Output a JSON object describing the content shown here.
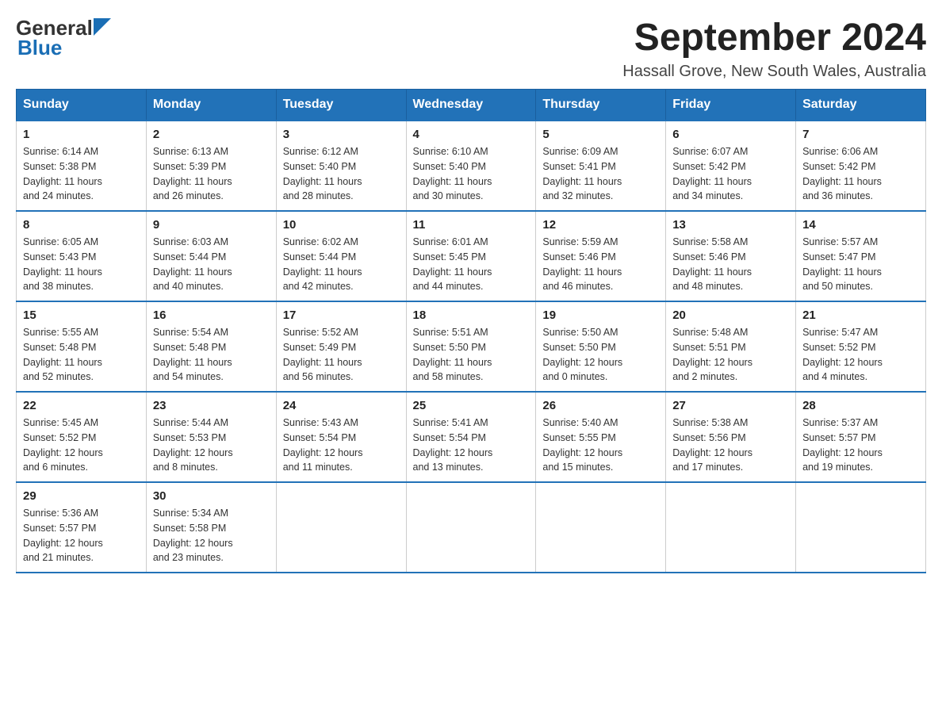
{
  "logo": {
    "text_general": "General",
    "text_blue": "Blue"
  },
  "title": "September 2024",
  "subtitle": "Hassall Grove, New South Wales, Australia",
  "weekdays": [
    "Sunday",
    "Monday",
    "Tuesday",
    "Wednesday",
    "Thursday",
    "Friday",
    "Saturday"
  ],
  "weeks": [
    [
      {
        "day": "1",
        "sunrise": "6:14 AM",
        "sunset": "5:38 PM",
        "daylight": "11 hours and 24 minutes."
      },
      {
        "day": "2",
        "sunrise": "6:13 AM",
        "sunset": "5:39 PM",
        "daylight": "11 hours and 26 minutes."
      },
      {
        "day": "3",
        "sunrise": "6:12 AM",
        "sunset": "5:40 PM",
        "daylight": "11 hours and 28 minutes."
      },
      {
        "day": "4",
        "sunrise": "6:10 AM",
        "sunset": "5:40 PM",
        "daylight": "11 hours and 30 minutes."
      },
      {
        "day": "5",
        "sunrise": "6:09 AM",
        "sunset": "5:41 PM",
        "daylight": "11 hours and 32 minutes."
      },
      {
        "day": "6",
        "sunrise": "6:07 AM",
        "sunset": "5:42 PM",
        "daylight": "11 hours and 34 minutes."
      },
      {
        "day": "7",
        "sunrise": "6:06 AM",
        "sunset": "5:42 PM",
        "daylight": "11 hours and 36 minutes."
      }
    ],
    [
      {
        "day": "8",
        "sunrise": "6:05 AM",
        "sunset": "5:43 PM",
        "daylight": "11 hours and 38 minutes."
      },
      {
        "day": "9",
        "sunrise": "6:03 AM",
        "sunset": "5:44 PM",
        "daylight": "11 hours and 40 minutes."
      },
      {
        "day": "10",
        "sunrise": "6:02 AM",
        "sunset": "5:44 PM",
        "daylight": "11 hours and 42 minutes."
      },
      {
        "day": "11",
        "sunrise": "6:01 AM",
        "sunset": "5:45 PM",
        "daylight": "11 hours and 44 minutes."
      },
      {
        "day": "12",
        "sunrise": "5:59 AM",
        "sunset": "5:46 PM",
        "daylight": "11 hours and 46 minutes."
      },
      {
        "day": "13",
        "sunrise": "5:58 AM",
        "sunset": "5:46 PM",
        "daylight": "11 hours and 48 minutes."
      },
      {
        "day": "14",
        "sunrise": "5:57 AM",
        "sunset": "5:47 PM",
        "daylight": "11 hours and 50 minutes."
      }
    ],
    [
      {
        "day": "15",
        "sunrise": "5:55 AM",
        "sunset": "5:48 PM",
        "daylight": "11 hours and 52 minutes."
      },
      {
        "day": "16",
        "sunrise": "5:54 AM",
        "sunset": "5:48 PM",
        "daylight": "11 hours and 54 minutes."
      },
      {
        "day": "17",
        "sunrise": "5:52 AM",
        "sunset": "5:49 PM",
        "daylight": "11 hours and 56 minutes."
      },
      {
        "day": "18",
        "sunrise": "5:51 AM",
        "sunset": "5:50 PM",
        "daylight": "11 hours and 58 minutes."
      },
      {
        "day": "19",
        "sunrise": "5:50 AM",
        "sunset": "5:50 PM",
        "daylight": "12 hours and 0 minutes."
      },
      {
        "day": "20",
        "sunrise": "5:48 AM",
        "sunset": "5:51 PM",
        "daylight": "12 hours and 2 minutes."
      },
      {
        "day": "21",
        "sunrise": "5:47 AM",
        "sunset": "5:52 PM",
        "daylight": "12 hours and 4 minutes."
      }
    ],
    [
      {
        "day": "22",
        "sunrise": "5:45 AM",
        "sunset": "5:52 PM",
        "daylight": "12 hours and 6 minutes."
      },
      {
        "day": "23",
        "sunrise": "5:44 AM",
        "sunset": "5:53 PM",
        "daylight": "12 hours and 8 minutes."
      },
      {
        "day": "24",
        "sunrise": "5:43 AM",
        "sunset": "5:54 PM",
        "daylight": "12 hours and 11 minutes."
      },
      {
        "day": "25",
        "sunrise": "5:41 AM",
        "sunset": "5:54 PM",
        "daylight": "12 hours and 13 minutes."
      },
      {
        "day": "26",
        "sunrise": "5:40 AM",
        "sunset": "5:55 PM",
        "daylight": "12 hours and 15 minutes."
      },
      {
        "day": "27",
        "sunrise": "5:38 AM",
        "sunset": "5:56 PM",
        "daylight": "12 hours and 17 minutes."
      },
      {
        "day": "28",
        "sunrise": "5:37 AM",
        "sunset": "5:57 PM",
        "daylight": "12 hours and 19 minutes."
      }
    ],
    [
      {
        "day": "29",
        "sunrise": "5:36 AM",
        "sunset": "5:57 PM",
        "daylight": "12 hours and 21 minutes."
      },
      {
        "day": "30",
        "sunrise": "5:34 AM",
        "sunset": "5:58 PM",
        "daylight": "12 hours and 23 minutes."
      },
      null,
      null,
      null,
      null,
      null
    ]
  ],
  "labels": {
    "sunrise": "Sunrise:",
    "sunset": "Sunset:",
    "daylight": "Daylight:"
  }
}
